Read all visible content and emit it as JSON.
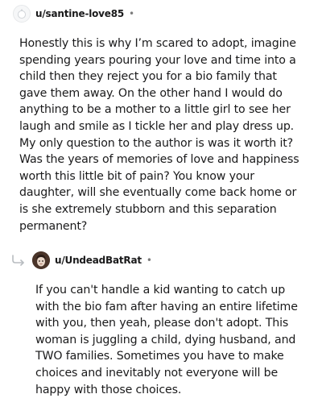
{
  "comments": [
    {
      "username": "u/santine-love85",
      "separator": "•",
      "avatar_icon": "default-snoo-avatar-icon",
      "body": "Honestly this is why I’m scared to adopt, imagine spending years pouring your love and time into a child then they reject you for a bio family that gave them away. On the other hand I would do anything to be a mother to a little girl to see her laugh and smile as I tickle her and play dress up. My only question to the author is was it worth it? Was the years of memories of love and happiness worth this little bit of pain? You know your daughter, will she eventually come back home or is she extremely stubborn and this separation permanent?"
    },
    {
      "username": "u/UndeadBatRat",
      "separator": "•",
      "avatar_icon": "user-avatar-icon",
      "reply_icon": "reply-arrow-icon",
      "body": "If you can't handle a kid wanting to catch up with the bio fam after having an entire lifetime with you, then yeah, please don't adopt. This woman is juggling a child, dying husband, and TWO families. Sometimes you have to make choices and inevitably not everyone will be happy with those choices."
    }
  ]
}
